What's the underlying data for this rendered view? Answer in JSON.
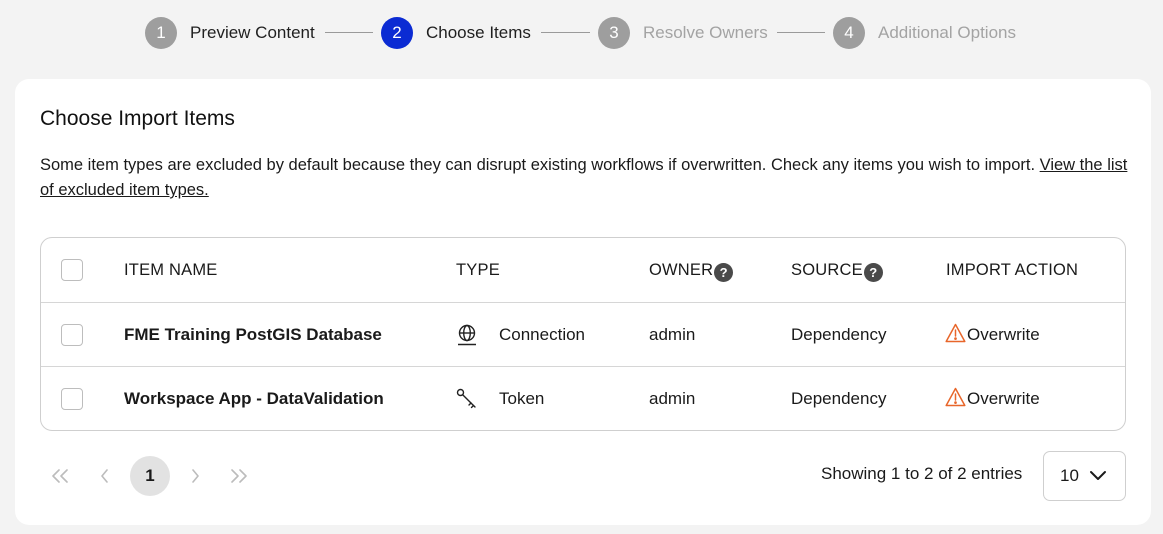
{
  "stepper": {
    "steps": [
      {
        "number": "1",
        "label": "Preview Content",
        "state": "done"
      },
      {
        "number": "2",
        "label": "Choose Items",
        "state": "active"
      },
      {
        "number": "3",
        "label": "Resolve Owners",
        "state": "upcoming"
      },
      {
        "number": "4",
        "label": "Additional Options",
        "state": "upcoming"
      }
    ]
  },
  "card": {
    "title": "Choose Import Items",
    "description": "Some item types are excluded by default because they can disrupt existing workflows if overwritten. Check any items you wish to import. ",
    "link_text": "View the list of excluded item types."
  },
  "table": {
    "headers": {
      "item_name": "ITEM NAME",
      "type": "TYPE",
      "owner": "OWNER",
      "source": "SOURCE",
      "import_action": "IMPORT ACTION",
      "help_glyph": "?"
    },
    "rows": [
      {
        "name": "FME Training PostGIS Database",
        "type": "Connection",
        "type_icon": "globe-icon",
        "owner": "admin",
        "source": "Dependency",
        "action": "Overwrite",
        "action_icon": "warning-icon",
        "checked": false
      },
      {
        "name": "Workspace App - DataValidation",
        "type": "Token",
        "type_icon": "key-icon",
        "owner": "admin",
        "source": "Dependency",
        "action": "Overwrite",
        "action_icon": "warning-icon",
        "checked": false
      }
    ]
  },
  "pagination": {
    "current_page": "1",
    "showing_text": "Showing 1 to 2 of 2 entries",
    "page_size": "10"
  },
  "colors": {
    "active_step": "#0b2bd3",
    "inactive_step": "#9e9e9e",
    "warning": "#e8662a"
  }
}
